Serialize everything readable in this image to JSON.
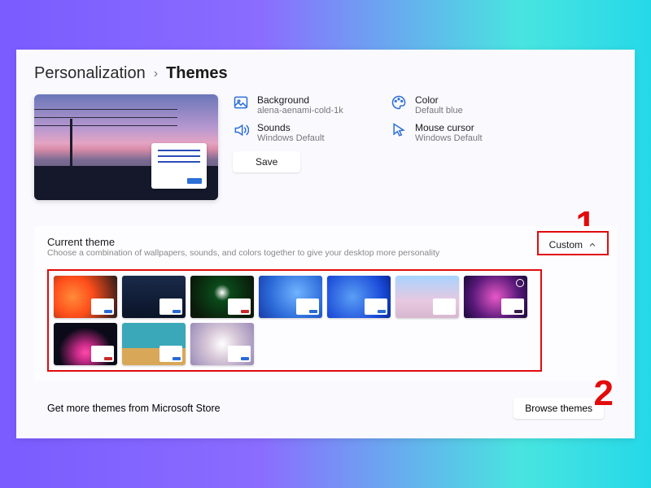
{
  "breadcrumb": {
    "parent": "Personalization",
    "current": "Themes"
  },
  "properties": {
    "background": {
      "label": "Background",
      "value": "alena-aenami-cold-1k"
    },
    "color": {
      "label": "Color",
      "value": "Default blue"
    },
    "sounds": {
      "label": "Sounds",
      "value": "Windows Default"
    },
    "cursor": {
      "label": "Mouse cursor",
      "value": "Windows Default"
    },
    "save_label": "Save"
  },
  "section": {
    "title": "Current theme",
    "subtitle": "Choose a combination of wallpapers, sounds, and colors together to give your desktop more personality",
    "selected": "Custom"
  },
  "themes": [
    {
      "accent": "#2a6ad8"
    },
    {
      "accent": "#2a6ad8"
    },
    {
      "accent": "#c82a2a"
    },
    {
      "accent": "#2a6ad8"
    },
    {
      "accent": "#2a6ad8"
    },
    {
      "accent": "#ffffff"
    },
    {
      "accent": "#3a1a4a"
    },
    {
      "accent": "#c82a2a"
    },
    {
      "accent": "#2a6ad8"
    },
    {
      "accent": "#2a6ad8"
    }
  ],
  "store": {
    "label": "Get more themes from Microsoft Store",
    "button": "Browse themes"
  },
  "annotations": {
    "one": "1",
    "two": "2"
  }
}
